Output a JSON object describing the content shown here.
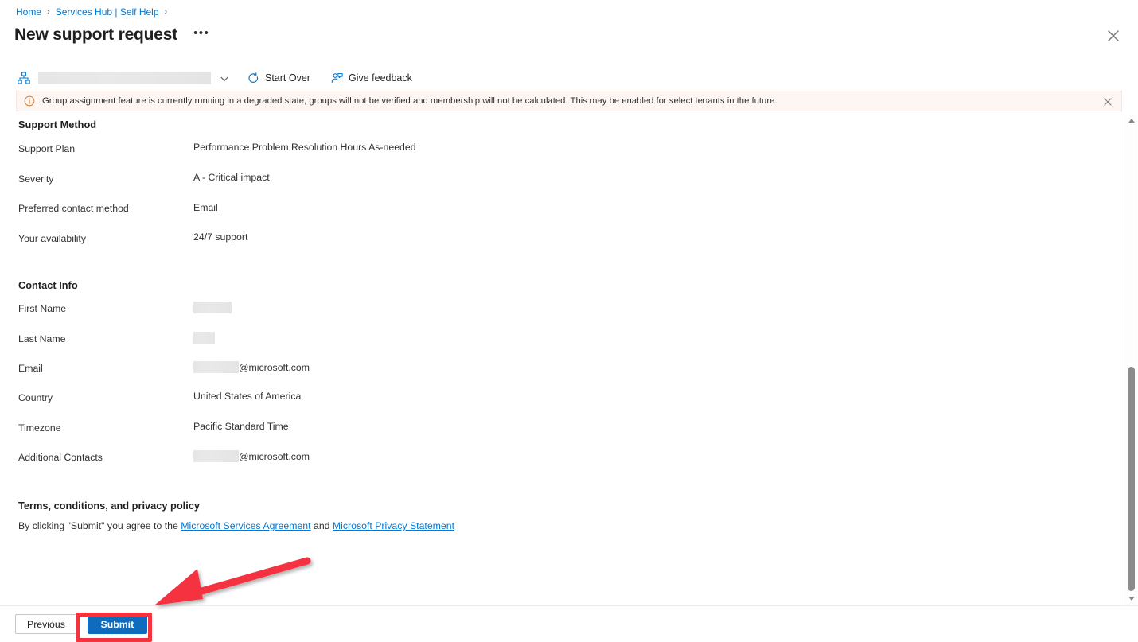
{
  "breadcrumb": {
    "items": [
      {
        "label": "Home"
      },
      {
        "label": "Services Hub | Self Help"
      }
    ],
    "separator": "›"
  },
  "header": {
    "title": "New support request",
    "ellipsis_label": "•••",
    "close_icon": "close-icon"
  },
  "command_bar": {
    "subscription_picker": {
      "icon": "hierarchy-icon",
      "value": "",
      "chevron": "chevron-down-icon"
    },
    "buttons": [
      {
        "label": "Start Over",
        "icon": "refresh-icon"
      },
      {
        "label": "Give feedback",
        "icon": "feedback-person-icon"
      }
    ]
  },
  "banner": {
    "icon": "info-circle-icon",
    "text": "Group assignment feature is currently running in a degraded state, groups will not be verified and membership will not be calculated. This may be enabled for select tenants in the future.",
    "close_icon": "close-icon",
    "background_color": "#fdf6f3",
    "icon_color": "#d87b2a"
  },
  "sections": {
    "support_method": {
      "heading": "Support Method",
      "rows": [
        {
          "label": "Support Plan",
          "value": "Performance Problem Resolution Hours As-needed",
          "redacted": false
        },
        {
          "label": "Severity",
          "value": "A - Critical impact",
          "redacted": false
        },
        {
          "label": "Preferred contact method",
          "value": "Email",
          "redacted": false
        },
        {
          "label": "Your availability",
          "value": "24/7 support",
          "redacted": false
        }
      ]
    },
    "contact_info": {
      "heading": "Contact Info",
      "rows": [
        {
          "label": "First Name",
          "value": "",
          "redacted": true,
          "redact_width": 48,
          "suffix": ""
        },
        {
          "label": "Last Name",
          "value": "",
          "redacted": true,
          "redact_width": 27,
          "suffix": ""
        },
        {
          "label": "Email",
          "value": "",
          "redacted": true,
          "redact_width": 57,
          "suffix": "@microsoft.com"
        },
        {
          "label": "Country",
          "value": "United States of America",
          "redacted": false,
          "suffix": ""
        },
        {
          "label": "Timezone",
          "value": "Pacific Standard Time",
          "redacted": false,
          "suffix": ""
        },
        {
          "label": "Additional Contacts",
          "value": "",
          "redacted": true,
          "redact_width": 57,
          "suffix": "@microsoft.com"
        }
      ]
    },
    "terms": {
      "heading": "Terms, conditions, and privacy policy",
      "text_before": "By clicking \"Submit\" you agree to the ",
      "link1": "Microsoft Services Agreement",
      "text_middle": " and ",
      "link2": "Microsoft Privacy Statement"
    }
  },
  "footer": {
    "previous_label": "Previous",
    "submit_label": "Submit",
    "submit_color": "#0f6cbd"
  },
  "scrollbar": {
    "up_arrow": "scroll-up-arrow",
    "down_arrow": "scroll-down-arrow",
    "thumb": "scroll-thumb"
  },
  "annotations": {
    "highlight_color": "#f5333f",
    "highlight_target": "Submit",
    "arrow": "red-arrow-pointing-to-submit"
  }
}
